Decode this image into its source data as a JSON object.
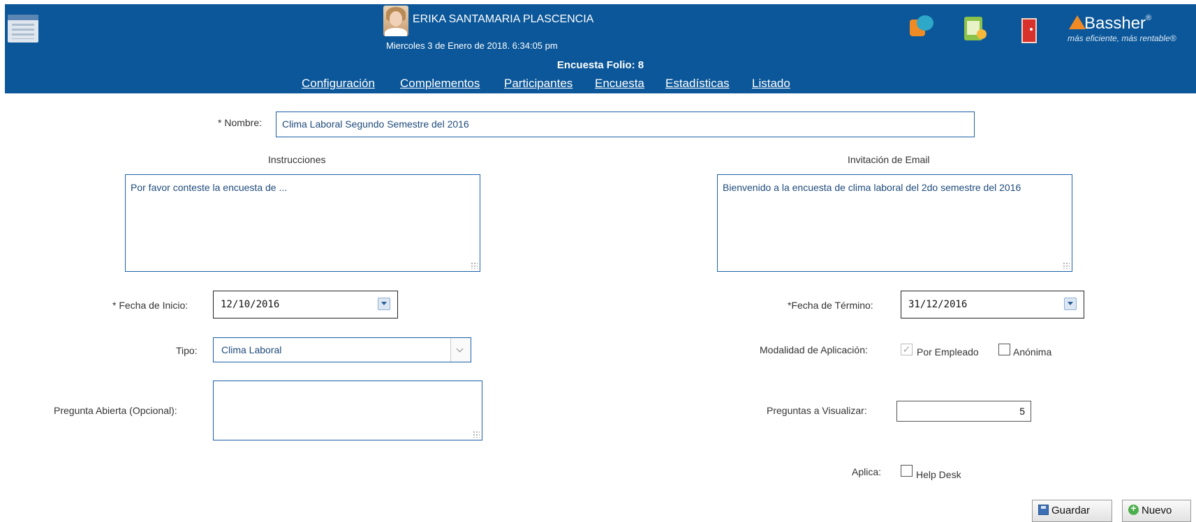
{
  "header": {
    "user_name": "ERIKA SANTAMARIA PLASCENCIA",
    "datetime": "Miercoles 3 de Enero de 2018. 6:34:05 pm",
    "folio_title": "Encuesta Folio: 8",
    "nav": [
      "Configuración",
      "Complementos",
      "Participantes",
      "Encuesta",
      "Estadísticas",
      "Listado"
    ],
    "logo": {
      "name": "Bassher",
      "reg": "®",
      "tagline": "más eficiente, más rentable®"
    },
    "icons": [
      "app-icon",
      "chat-icon",
      "document-icon",
      "exit-icon"
    ]
  },
  "form": {
    "nombre_label": "* Nombre:",
    "nombre_value": "Clima Laboral Segundo Semestre del 2016",
    "instrucciones_label": "Instrucciones",
    "instrucciones_value": "Por favor conteste la encuesta de ...",
    "invitacion_label": "Invitación de Email",
    "invitacion_value": "Bienvenido a la encuesta de clima laboral del 2do semestre del 2016",
    "fecha_inicio_label": "* Fecha de Inicio:",
    "fecha_inicio_value": "12/10/2016",
    "fecha_termino_label": "*Fecha de Término:",
    "fecha_termino_value": "31/12/2016",
    "tipo_label": "Tipo:",
    "tipo_value": "Clima Laboral",
    "modalidad_label": "Modalidad de Aplicación:",
    "modalidad_por_empleado": "Por Empleado",
    "modalidad_por_empleado_checked": true,
    "modalidad_anonima": "Anónima",
    "modalidad_anonima_checked": false,
    "pregunta_abierta_label": "Pregunta Abierta (Opcional):",
    "pregunta_abierta_value": "",
    "preguntas_visualizar_label": "Preguntas a Visualizar:",
    "preguntas_visualizar_value": "5",
    "aplica_label": "Aplica:",
    "help_desk": "Help Desk",
    "help_desk_checked": false
  },
  "buttons": {
    "guardar": "Guardar",
    "nuevo": "Nuevo"
  },
  "colors": {
    "header_bg": "#0b5799",
    "input_border": "#1b5fa6"
  }
}
